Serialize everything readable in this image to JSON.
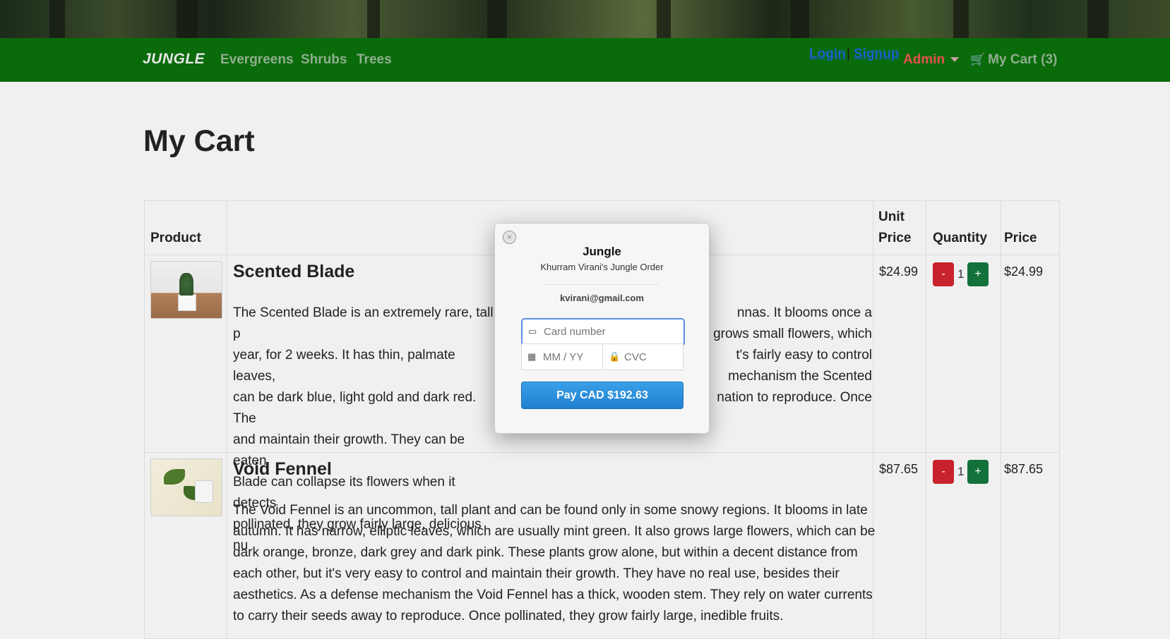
{
  "navbar": {
    "brand": "JUNGLE",
    "links": [
      "Evergreens",
      "Shrubs",
      "Trees"
    ],
    "login": "Login",
    "separator": "|",
    "signup": "Signup",
    "admin": "Admin",
    "cart": "My Cart (3)"
  },
  "page": {
    "title": "My Cart"
  },
  "table": {
    "headers": {
      "product": "Product",
      "unit_price_1": "Unit",
      "unit_price_2": "Price",
      "quantity": "Quantity",
      "price": "Price"
    },
    "rows": [
      {
        "name": "Scented Blade",
        "desc_lines": [
          "The Scented Blade is an extremely rare, tall p",
          "year, for 2 weeks. It has thin, palmate leaves,",
          "can be dark blue, light gold and dark red. The",
          "and maintain their growth. They can be eaten",
          "Blade can collapse its flowers when it detects",
          "pollinated, they grow fairly large, delicious nu"
        ],
        "desc_right_lines": [
          "nnas. It blooms once a",
          "grows small flowers, which",
          "t's fairly easy to control",
          "mechanism the Scented",
          "nation to reproduce. Once",
          ""
        ],
        "unit_price": "$24.99",
        "qty": "1",
        "price": "$24.99",
        "minus": "-",
        "plus": "+"
      },
      {
        "name": "Void Fennel",
        "desc_lines": [
          "The Void Fennel is an uncommon, tall plant and can be found only in some snowy regions. It blooms in late",
          "autumn. It has narrow, elliptic leaves, which are usually mint green. It also grows large flowers, which can be",
          "dark orange, bronze, dark grey and dark pink. These plants grow alone, but within a decent distance from",
          "each other, but it's very easy to control and maintain their growth. They have no real use, besides their",
          "aesthetics. As a defense mechanism the Void Fennel has a thick, wooden stem. They rely on water currents",
          "to carry their seeds away to reproduce. Once pollinated, they grow fairly large, inedible fruits."
        ],
        "unit_price": "$87.65",
        "qty": "1",
        "price": "$87.65",
        "minus": "-",
        "plus": "+"
      }
    ]
  },
  "checkout": {
    "close": "×",
    "title": "Jungle",
    "subtitle": "Khurram Virani's Jungle Order",
    "email": "kvirani@gmail.com",
    "card_placeholder": "Card number",
    "expiry_placeholder": "MM / YY",
    "cvc_placeholder": "CVC",
    "pay_label": "Pay CAD $192.63"
  },
  "colors": {
    "navbar": "#0a6b0a",
    "minus": "#c8232c",
    "plus": "#13723a",
    "pay": "#1f7fcf"
  }
}
